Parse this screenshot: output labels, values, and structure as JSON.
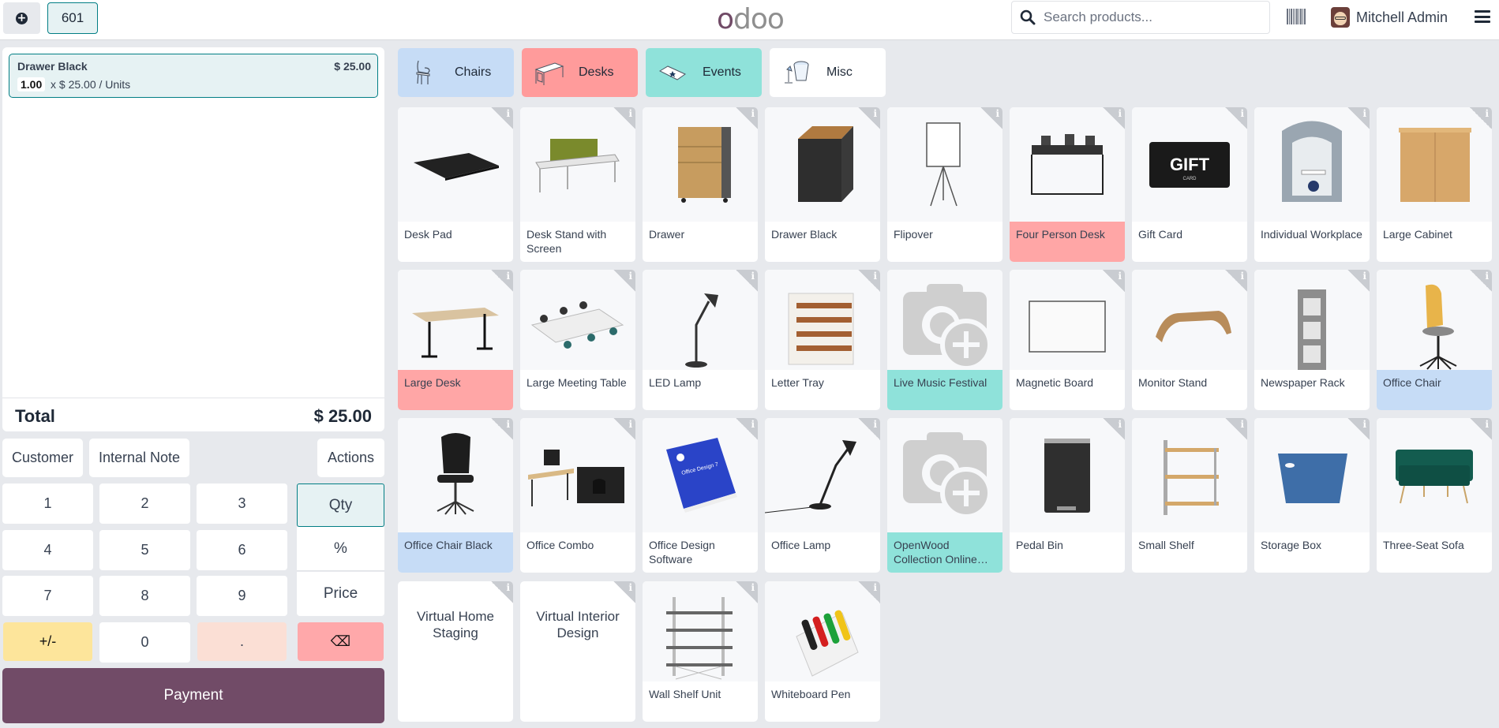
{
  "topbar": {
    "new_order_icon": "plus-circle-icon",
    "order_tab": "601",
    "logo": "odoo",
    "search_placeholder": "Search products...",
    "barcode_icon": "barcode-icon",
    "user_name": "Mitchell Admin",
    "menu_icon": "hamburger-menu-icon"
  },
  "order": {
    "lines": [
      {
        "name": "Drawer Black",
        "price": "$ 25.00",
        "qty": "1.00",
        "unit": "x $ 25.00 / Units"
      }
    ],
    "total_label": "Total",
    "total_value": "$ 25.00"
  },
  "controls": {
    "customer": "Customer",
    "internal_note": "Internal Note",
    "actions": "Actions"
  },
  "numpad": {
    "keys": [
      "1",
      "2",
      "3",
      "4",
      "5",
      "6",
      "7",
      "8",
      "9",
      "+/-",
      "0",
      "."
    ],
    "modes": {
      "qty": "Qty",
      "percent": "%",
      "price": "Price"
    },
    "backspace": "⌫",
    "active_mode": "Qty"
  },
  "payment_label": "Payment",
  "categories": [
    {
      "name": "Chairs",
      "color": "#c6dcf6"
    },
    {
      "name": "Desks",
      "color": "#ff9b9b"
    },
    {
      "name": "Events",
      "color": "#8fe2da"
    },
    {
      "name": "Misc",
      "color": "#ffffff"
    }
  ],
  "products": [
    {
      "name": "Desk Pad",
      "category": ""
    },
    {
      "name": "Desk Stand with Screen",
      "category": ""
    },
    {
      "name": "Drawer",
      "category": ""
    },
    {
      "name": "Drawer Black",
      "category": ""
    },
    {
      "name": "Flipover",
      "category": ""
    },
    {
      "name": "Four Person Desk",
      "category": "Desks"
    },
    {
      "name": "Gift Card",
      "category": ""
    },
    {
      "name": "Individual Workplace",
      "category": ""
    },
    {
      "name": "Large Cabinet",
      "category": ""
    },
    {
      "name": "Large Desk",
      "category": "Desks"
    },
    {
      "name": "Large Meeting Table",
      "category": ""
    },
    {
      "name": "LED Lamp",
      "category": ""
    },
    {
      "name": "Letter Tray",
      "category": ""
    },
    {
      "name": "Live Music Festival",
      "category": "Events"
    },
    {
      "name": "Magnetic Board",
      "category": ""
    },
    {
      "name": "Monitor Stand",
      "category": ""
    },
    {
      "name": "Newspaper Rack",
      "category": ""
    },
    {
      "name": "Office Chair",
      "category": "Chairs"
    },
    {
      "name": "Office Chair Black",
      "category": "Chairs"
    },
    {
      "name": "Office Combo",
      "category": ""
    },
    {
      "name": "Office Design Software",
      "category": ""
    },
    {
      "name": "Office Lamp",
      "category": ""
    },
    {
      "name": "OpenWood Collection Online…",
      "category": "Events"
    },
    {
      "name": "Pedal Bin",
      "category": ""
    },
    {
      "name": "Small Shelf",
      "category": ""
    },
    {
      "name": "Storage Box",
      "category": ""
    },
    {
      "name": "Three-Seat Sofa",
      "category": ""
    },
    {
      "name": "Virtual Home Staging",
      "category": ""
    },
    {
      "name": "Virtual Interior Design",
      "category": ""
    },
    {
      "name": "Wall Shelf Unit",
      "category": ""
    },
    {
      "name": "Whiteboard Pen",
      "category": ""
    }
  ],
  "info_glyph": "i",
  "gift_card_text": "GIFT"
}
